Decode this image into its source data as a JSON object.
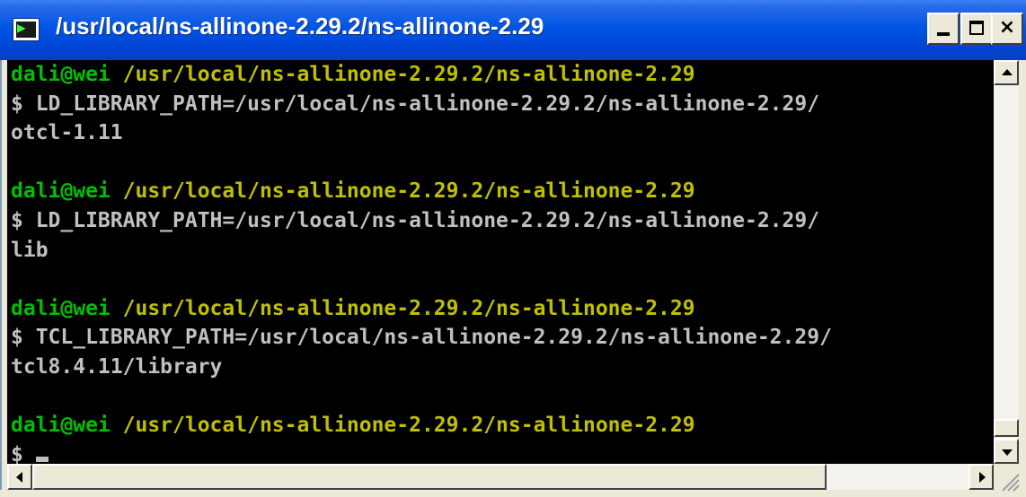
{
  "window": {
    "title": "/usr/local/ns-allinone-2.29.2/ns-allinone-2.29",
    "icon": "terminal-icon",
    "buttons": {
      "minimize": "minimize-icon",
      "maximize": "maximize-icon",
      "close": "×"
    }
  },
  "terminal": {
    "colors": {
      "background": "#000000",
      "user": "#00c000",
      "path": "#c0c000",
      "text": "#c0c0c0"
    },
    "blocks": [
      {
        "user": "dali@wei",
        "path": " /usr/local/ns-allinone-2.29.2/ns-allinone-2.29",
        "command_line1": "$ LD_LIBRARY_PATH=/usr/local/ns-allinone-2.29.2/ns-allinone-2.29/",
        "command_line2": "otcl-1.11"
      },
      {
        "user": "dali@wei",
        "path": " /usr/local/ns-allinone-2.29.2/ns-allinone-2.29",
        "command_line1": "$ LD_LIBRARY_PATH=/usr/local/ns-allinone-2.29.2/ns-allinone-2.29/",
        "command_line2": "lib"
      },
      {
        "user": "dali@wei",
        "path": " /usr/local/ns-allinone-2.29.2/ns-allinone-2.29",
        "command_line1": "$ TCL_LIBRARY_PATH=/usr/local/ns-allinone-2.29.2/ns-allinone-2.29/",
        "command_line2": "tcl8.4.11/library"
      }
    ],
    "current": {
      "user": "dali@wei",
      "path": " /usr/local/ns-allinone-2.29.2/ns-allinone-2.29",
      "prompt": "$ "
    }
  }
}
